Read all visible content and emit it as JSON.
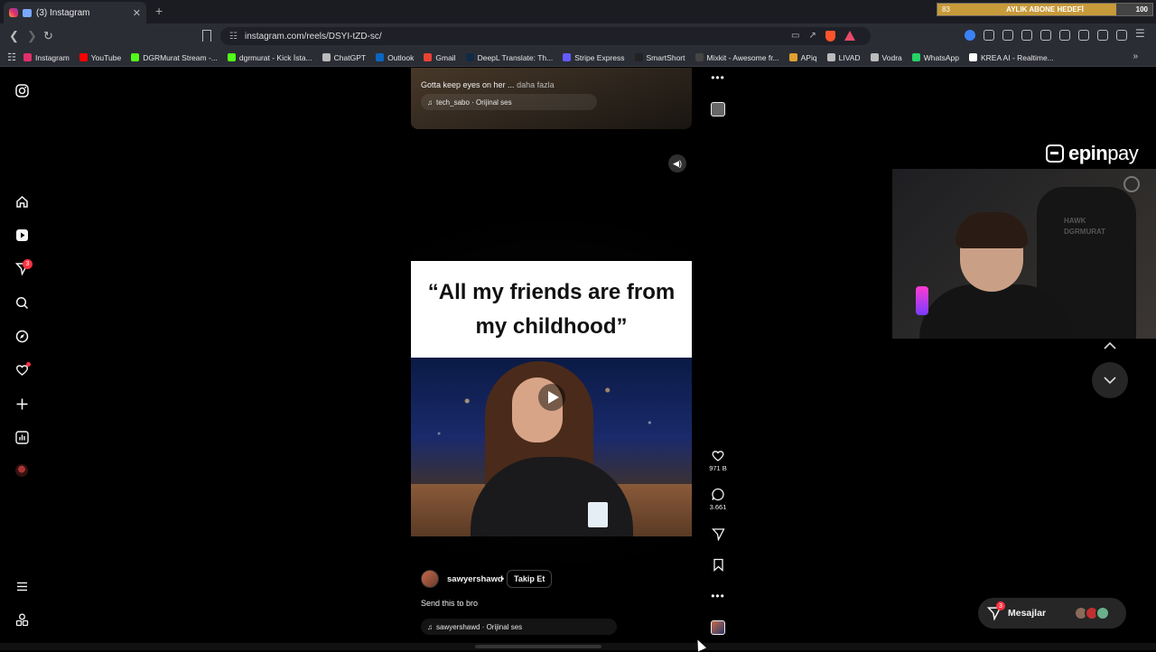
{
  "browser": {
    "tab": {
      "title": "(3) Instagram",
      "close": "✕"
    },
    "new_tab": "+",
    "url": "instagram.com/reels/DSYI-tZD-sc/",
    "subscriber_goal": {
      "current": "83",
      "label": "AYLIK ABONE HEDEFİ",
      "target": "100",
      "progress": 0.83
    },
    "bookmarks": [
      {
        "label": "Instagram",
        "color": "#e1306c"
      },
      {
        "label": "YouTube",
        "color": "#ff0000"
      },
      {
        "label": "DGRMurat Stream -...",
        "color": "#53fc18"
      },
      {
        "label": "dgrmurat - Kick İsta...",
        "color": "#53fc18"
      },
      {
        "label": "ChatGPT",
        "color": "#bbbbbb"
      },
      {
        "label": "Outlook",
        "color": "#0a66c2"
      },
      {
        "label": "Gmail",
        "color": "#ea4335"
      },
      {
        "label": "DeepL Translate: Th...",
        "color": "#0f2b46"
      },
      {
        "label": "Stripe Express",
        "color": "#635bff"
      },
      {
        "label": "SmartShort",
        "color": "#222222"
      },
      {
        "label": "Mixkit - Awesome fr...",
        "color": "#444444"
      },
      {
        "label": "APiq",
        "color": "#e0a030"
      },
      {
        "label": "LIVAD",
        "color": "#bbbbbb"
      },
      {
        "label": "Vodra",
        "color": "#bbbbbb"
      },
      {
        "label": "WhatsApp",
        "color": "#25d366"
      },
      {
        "label": "KREA AI - Realtime...",
        "color": "#ffffff"
      }
    ]
  },
  "sidebar": {
    "notifications_badge": "3"
  },
  "previous_reel": {
    "caption": "Gotta keep eyes on her ...",
    "more_label": "daha fazla",
    "audio": "tech_sabo · Orijinal ses"
  },
  "reel": {
    "quote": "“All my friends are from my childhood”",
    "username": "sawyershawd",
    "separator": "•",
    "follow_label": "Takip Et",
    "caption": "Send this to bro",
    "audio": "sawyershawd · Orijinal ses",
    "likes": "971 B",
    "comments": "3.661"
  },
  "overlay": {
    "brand_left": "epin",
    "brand_right": "pay",
    "webcam_chair_text": "HAWK DGRMURAT"
  },
  "messages": {
    "label": "Mesajlar",
    "badge": "3"
  }
}
